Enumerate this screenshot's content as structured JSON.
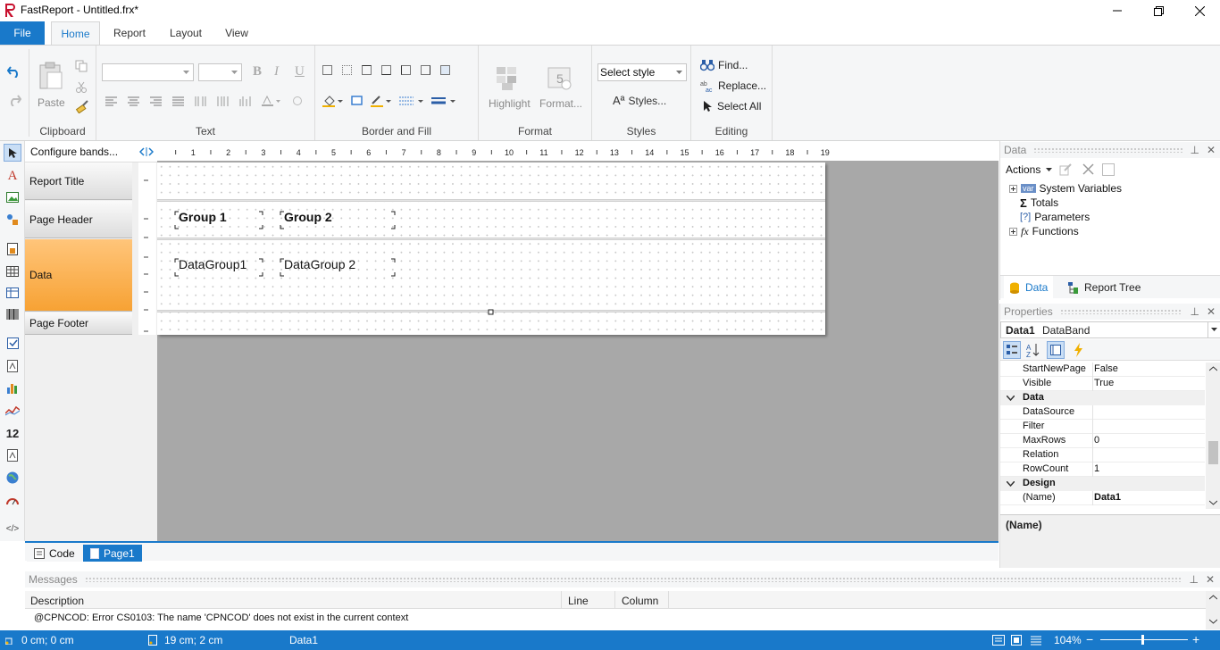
{
  "app": {
    "title": "FastReport - Untitled.frx*"
  },
  "ribbon_tabs": [
    "File",
    "Home",
    "Report",
    "Layout",
    "View"
  ],
  "ribbon": {
    "clipboard": {
      "paste": "Paste",
      "label": "Clipboard"
    },
    "text": {
      "bold": "B",
      "italic": "I",
      "underline": "U",
      "label": "Text"
    },
    "border": {
      "label": "Border and Fill"
    },
    "format": {
      "highlight": "Highlight",
      "format": "Format...",
      "label": "Format"
    },
    "styles": {
      "select_style": "Select style",
      "styles": "Styles...",
      "label": "Styles"
    },
    "editing": {
      "find": "Find...",
      "replace": "Replace...",
      "select_all": "Select All",
      "label": "Editing"
    }
  },
  "toolbox": {
    "text_tool": "A",
    "number_tool": "12",
    "html_tool": "</>"
  },
  "bands": {
    "configure": "Configure bands...",
    "items": [
      "Report Title",
      "Page Header",
      "Data",
      "Page Footer"
    ]
  },
  "ruler": {
    "marks": [
      "1",
      "2",
      "3",
      "4",
      "5",
      "6",
      "7",
      "8",
      "9",
      "10",
      "11",
      "12",
      "13",
      "14",
      "15",
      "16",
      "17",
      "18",
      "19"
    ]
  },
  "design": {
    "page_header": [
      "Group 1",
      "Group 2"
    ],
    "data_band": [
      "DataGroup1",
      "DataGroup 2"
    ]
  },
  "doc_tabs": [
    "Code",
    "Page1"
  ],
  "messages": {
    "title": "Messages",
    "columns": [
      "Description",
      "Line",
      "Column"
    ],
    "rows": [
      "@CPNCOD: Error CS0103: The name 'CPNCOD' does not exist in the current context"
    ]
  },
  "data_panel": {
    "title": "Data",
    "actions": "Actions",
    "tree": [
      "System Variables",
      "Totals",
      "Parameters",
      "Functions"
    ],
    "tabs": [
      "Data",
      "Report Tree"
    ]
  },
  "properties": {
    "title": "Properties",
    "object_name": "Data1",
    "object_type": "DataBand",
    "rows_top": [
      {
        "name": "StartNewPage",
        "value": "False"
      },
      {
        "name": "Visible",
        "value": "True"
      }
    ],
    "cat_data": "Data",
    "rows_data": [
      {
        "name": "DataSource",
        "value": ""
      },
      {
        "name": "Filter",
        "value": ""
      },
      {
        "name": "MaxRows",
        "value": "0"
      },
      {
        "name": "Relation",
        "value": ""
      },
      {
        "name": "RowCount",
        "value": "1"
      }
    ],
    "cat_design": "Design",
    "rows_design": [
      {
        "name": "(Name)",
        "value": "Data1"
      }
    ],
    "description_title": "(Name)"
  },
  "status": {
    "position": "0 cm; 0 cm",
    "size": "19 cm; 2 cm",
    "object": "Data1",
    "zoom": "104%"
  },
  "colors": {
    "accent": "#1979ca",
    "band_selected": "#f7a234",
    "surface": "#a8a8a8"
  }
}
